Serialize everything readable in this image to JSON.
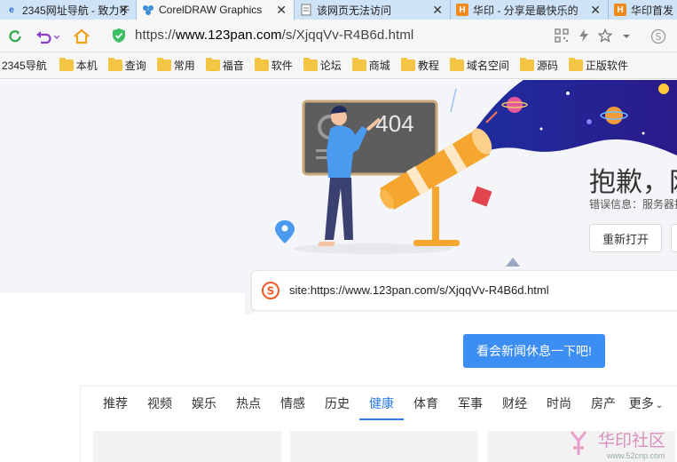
{
  "tabs": [
    {
      "label": "2345网址导航 - 致力于",
      "favicon": "e",
      "active": false
    },
    {
      "label": "CorelDRAW Graphics",
      "favicon": "corel",
      "active": true
    },
    {
      "label": "该网页无法访问",
      "favicon": "page",
      "active": false
    },
    {
      "label": "华印 - 分享是最快乐的",
      "favicon": "huayin",
      "active": false
    },
    {
      "label": "华印首发",
      "favicon": "huayin",
      "active": false
    }
  ],
  "address": {
    "prefix": "https://",
    "domain": "www.123pan.com",
    "path": "/s/XjqqVv-R4B6d.html"
  },
  "bookmarks": [
    {
      "label": "2345导航",
      "folder": false
    },
    {
      "label": "本机",
      "folder": true
    },
    {
      "label": "查询",
      "folder": true
    },
    {
      "label": "常用",
      "folder": true
    },
    {
      "label": "福音",
      "folder": true
    },
    {
      "label": "软件",
      "folder": true
    },
    {
      "label": "论坛",
      "folder": true
    },
    {
      "label": "商城",
      "folder": true
    },
    {
      "label": "教程",
      "folder": true
    },
    {
      "label": "域名空间",
      "folder": true
    },
    {
      "label": "源码",
      "folder": true
    },
    {
      "label": "正版软件",
      "folder": true
    }
  ],
  "error": {
    "code": "404",
    "title": "抱歉，网",
    "info": "错误信息：服务器找",
    "reopen_label": "重新打开"
  },
  "search": {
    "query": "site:https://www.123pan.com/s/XjqqVv-R4B6d.html"
  },
  "news_button_label": "看会新闻休息一下吧!",
  "news_tabs": [
    "推荐",
    "视频",
    "娱乐",
    "热点",
    "情感",
    "历史",
    "健康",
    "体育",
    "军事",
    "财经",
    "时尚",
    "房产",
    "更多"
  ],
  "news_active_tab": 6,
  "watermark": {
    "text": "华印社区",
    "url": "www.52cnp.com"
  },
  "colors": {
    "accent": "#3c8ef3",
    "tab_active_text": "#2b7de9",
    "tabbar": "#cfe3f7"
  }
}
